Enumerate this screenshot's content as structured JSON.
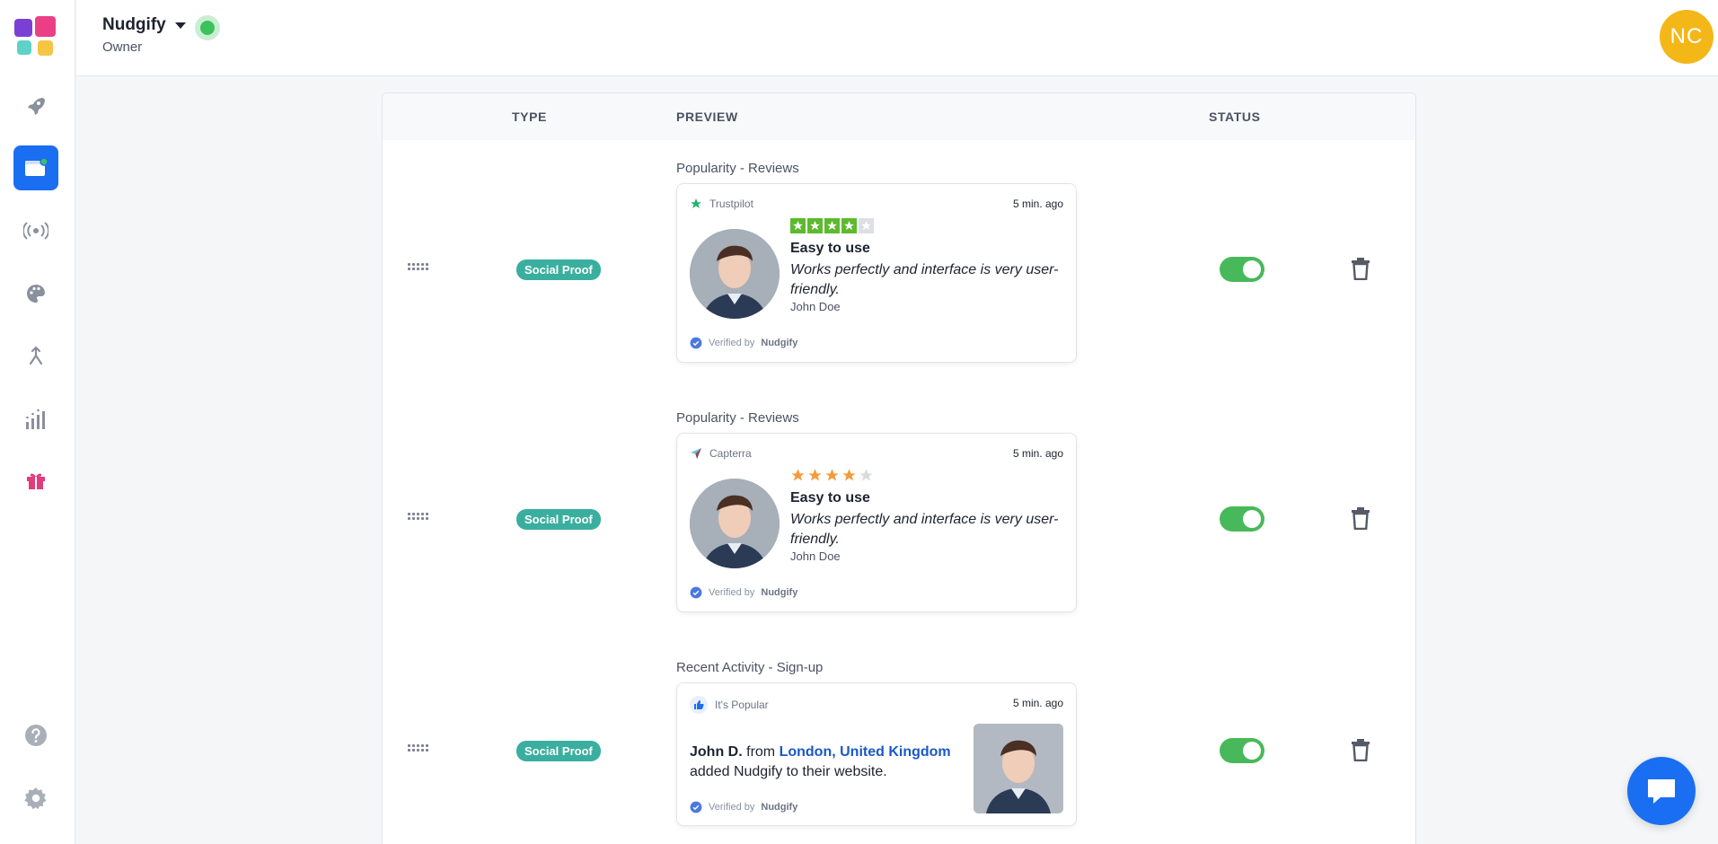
{
  "header": {
    "org_name": "Nudgify",
    "org_role": "Owner",
    "user_initials": "NC"
  },
  "sidebar": {
    "items": [
      {
        "icon": "rocket-icon",
        "active": false
      },
      {
        "icon": "notifications-icon",
        "active": true
      },
      {
        "icon": "broadcast-icon",
        "active": false
      },
      {
        "icon": "palette-icon",
        "active": false
      },
      {
        "icon": "merge-icon",
        "active": false
      },
      {
        "icon": "stats-icon",
        "active": false
      },
      {
        "icon": "gift-icon",
        "active": false
      },
      {
        "icon": "help-icon",
        "active": false
      },
      {
        "icon": "gear-icon",
        "active": false
      }
    ]
  },
  "table": {
    "columns": {
      "type": "TYPE",
      "preview": "PREVIEW",
      "status": "STATUS"
    },
    "rows": [
      {
        "type_badge": "Social Proof",
        "group_title": "Popularity - Reviews",
        "card": {
          "source": "Trustpilot",
          "time": "5 min. ago",
          "rating": 4,
          "headline": "Easy to use",
          "body": "Works perfectly and interface is very user-friendly.",
          "author": "John Doe",
          "verified_prefix": "Verified by",
          "verified_brand": "Nudgify"
        },
        "enabled": true
      },
      {
        "type_badge": "Social Proof",
        "group_title": "Popularity - Reviews",
        "card": {
          "source": "Capterra",
          "time": "5 min. ago",
          "rating": 4,
          "headline": "Easy to use",
          "body": "Works perfectly and interface is very user-friendly.",
          "author": "John Doe",
          "verified_prefix": "Verified by",
          "verified_brand": "Nudgify"
        },
        "enabled": true
      },
      {
        "type_badge": "Social Proof",
        "group_title": "Recent Activity - Sign-up",
        "card": {
          "source": "It's Popular",
          "time": "5 min. ago",
          "name": "John D.",
          "from": "from",
          "location": "London, United Kingdom",
          "action": "added Nudgify to their website.",
          "verified_prefix": "Verified by",
          "verified_brand": "Nudgify"
        },
        "enabled": true
      }
    ]
  },
  "colors": {
    "primary": "#1a6ef2",
    "badge": "#3aaf9f",
    "toggle_on": "#48b95a",
    "trustpilot_green": "#5dba2f",
    "capterra_orange": "#f39c3b",
    "avatar": "#f4b718"
  }
}
